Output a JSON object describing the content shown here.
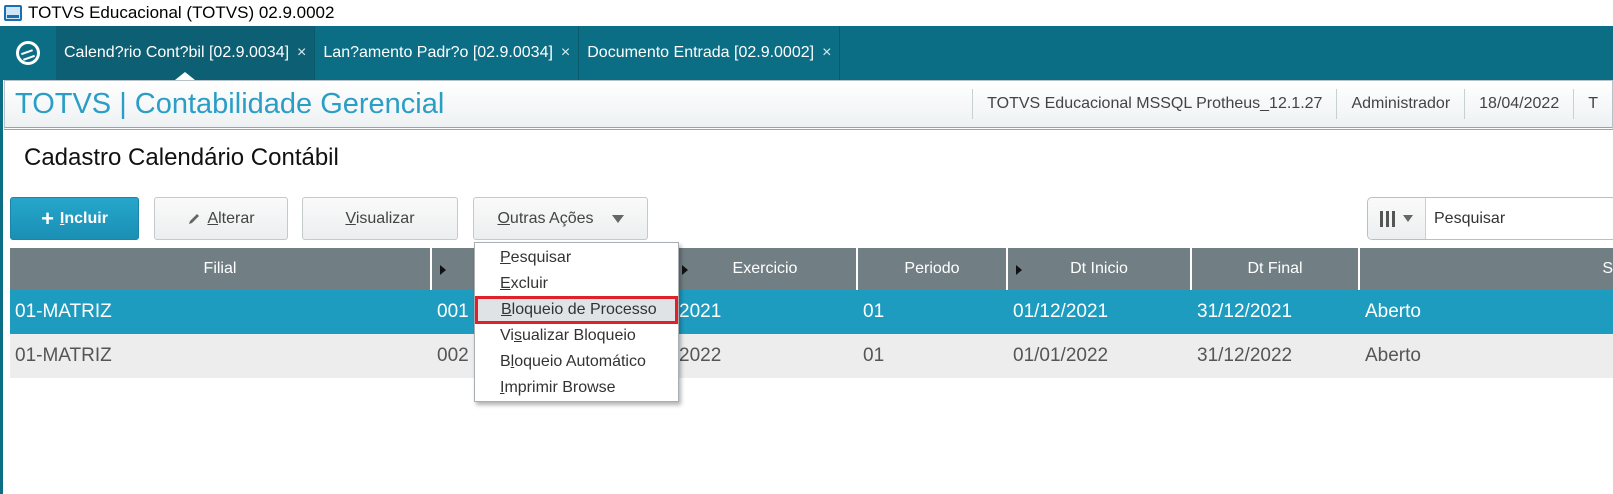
{
  "window": {
    "title": "TOTVS Educacional (TOTVS) 02.9.0002"
  },
  "tabs": [
    {
      "label": "Calend?rio Cont?bil [02.9.0034]",
      "active": true
    },
    {
      "label": "Lan?amento Padr?o [02.9.0034]",
      "active": false
    },
    {
      "label": "Documento Entrada [02.9.0002]",
      "active": false
    }
  ],
  "tab_close_glyph": "×",
  "module": {
    "brand": "TOTVS | Contabilidade Gerencial",
    "environment": "TOTVS Educacional MSSQL Protheus_12.1.27",
    "user": "Administrador",
    "date": "18/04/2022",
    "extra": "T"
  },
  "page": {
    "title": "Cadastro Calendário Contábil"
  },
  "actions": {
    "include": {
      "first": "I",
      "rest": "ncluir"
    },
    "alter": {
      "first": "A",
      "rest": "lterar"
    },
    "view": {
      "first": "V",
      "rest": "isualizar"
    },
    "other": {
      "first": "O",
      "rest": "utras Ações"
    }
  },
  "search": {
    "placeholder": "Pesquisar"
  },
  "grid": {
    "headers": [
      "Filial",
      "",
      "Exercicio",
      "Periodo",
      "Dt Inicio",
      "Dt Final",
      "S"
    ],
    "rows": [
      [
        "01-MATRIZ",
        "001",
        "2021",
        "01",
        "01/12/2021",
        "31/12/2021",
        "Aberto"
      ],
      [
        "01-MATRIZ",
        "002",
        "2022",
        "01",
        "01/01/2022",
        "31/12/2022",
        "Aberto"
      ]
    ]
  },
  "menu": {
    "items": [
      {
        "first": "P",
        "rest": "esquisar"
      },
      {
        "first": "E",
        "rest": "xcluir"
      },
      {
        "first": "B",
        "rest": "loqueio de Processo"
      },
      {
        "pre": "Vi",
        "first": "s",
        "rest": "ualizar Bloqueio"
      },
      {
        "pre": "B",
        "first": "l",
        "rest": "oqueio Automático"
      },
      {
        "first": "I",
        "rest": "mprimir Browse"
      }
    ]
  },
  "colors": {
    "accent": "#1e9cc0",
    "tabbar": "#0b6e84",
    "header_row": "#717f85",
    "highlight_border": "#e0202b"
  }
}
